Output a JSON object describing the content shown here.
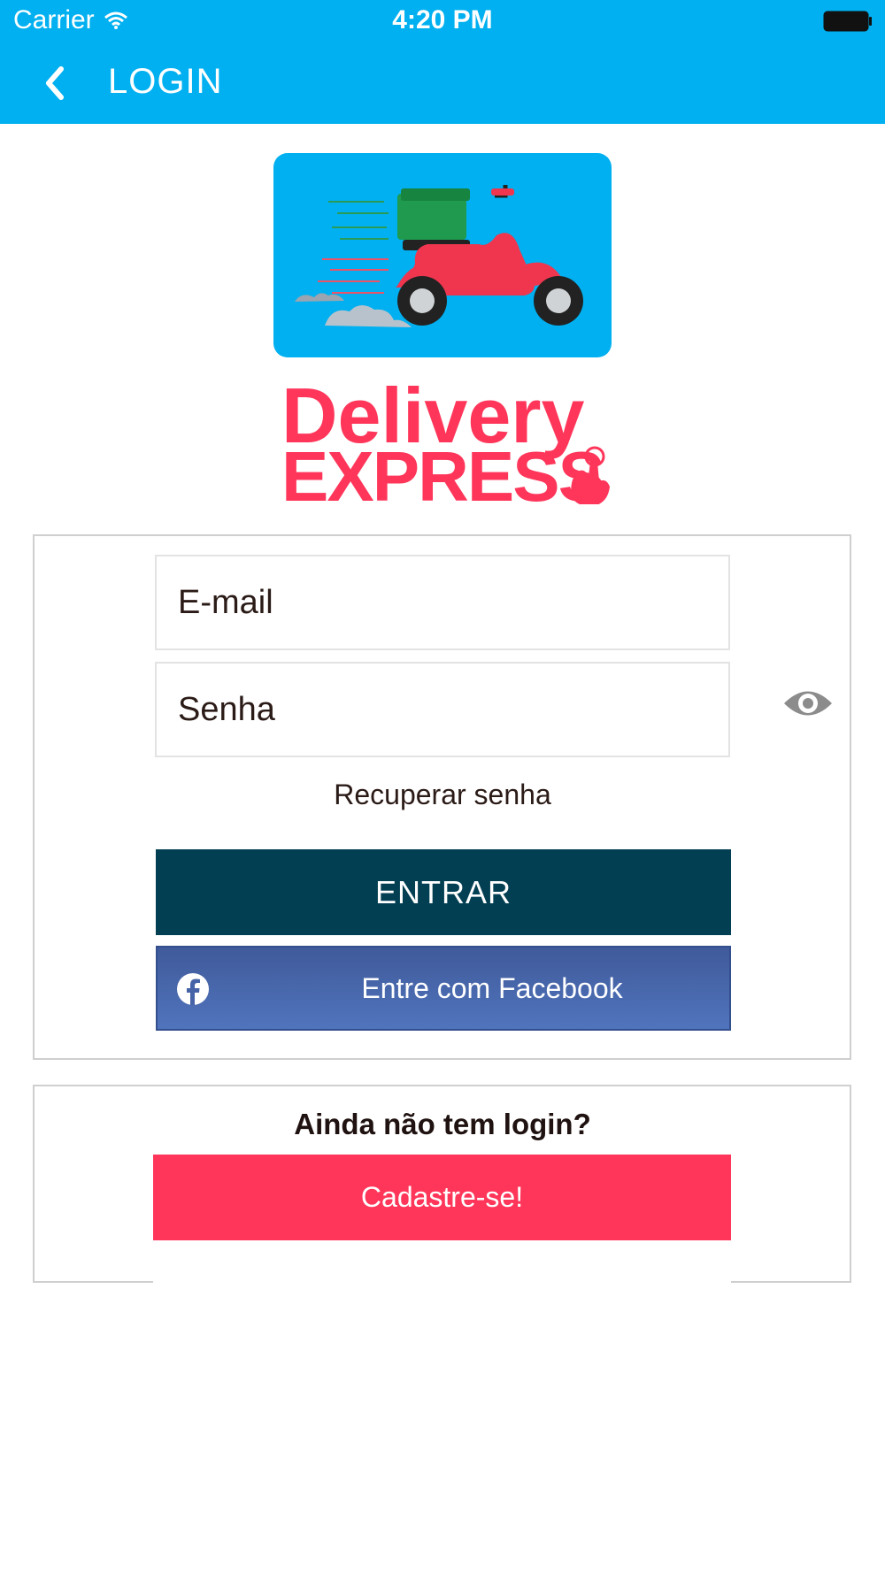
{
  "status_bar": {
    "carrier": "Carrier",
    "time": "4:20 PM"
  },
  "nav": {
    "title": "LOGIN"
  },
  "brand": {
    "line1": "Delivery",
    "line2": "EXPRESS"
  },
  "form": {
    "email_placeholder": "E-mail",
    "password_placeholder": "Senha",
    "recover_label": "Recuperar senha",
    "enter_label": "ENTRAR",
    "facebook_label": "Entre com Facebook"
  },
  "signup": {
    "question": "Ainda não tem login?",
    "button_label": "Cadastre-se!"
  },
  "colors": {
    "header_bg": "#00b0f0",
    "brand_pink": "#ff365a",
    "enter_button": "#033f53",
    "facebook_blue": "#4563a6"
  },
  "icons": [
    "wifi-icon",
    "battery-icon",
    "back-chevron-icon",
    "scooter-logo",
    "eye-icon",
    "facebook-icon"
  ]
}
